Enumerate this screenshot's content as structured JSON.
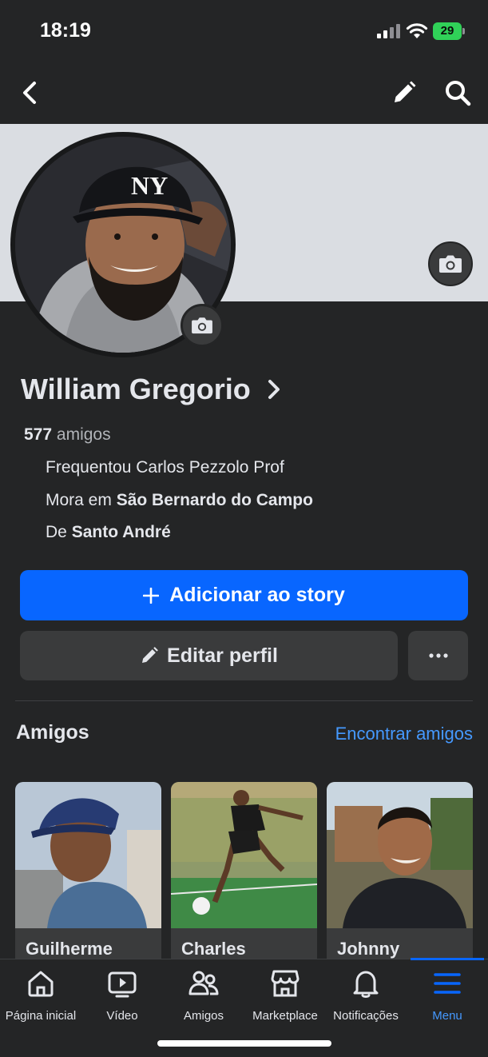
{
  "status_bar": {
    "time": "18:19",
    "battery": "29"
  },
  "profile": {
    "name": "William Gregorio",
    "friends_count": "577",
    "friends_label": "amigos",
    "studied_text": "Frequentou Carlos Pezzolo Prof",
    "lives_prefix": "Mora em",
    "lives_city": "São Bernardo do Campo",
    "from_prefix": "De",
    "from_city": "Santo André"
  },
  "actions": {
    "add_story": "Adicionar ao story",
    "edit_profile": "Editar perfil"
  },
  "friends_section": {
    "title": "Amigos",
    "link": "Encontrar amigos",
    "cards": [
      {
        "name": "Guilherme"
      },
      {
        "name": "Charles"
      },
      {
        "name": "Johnny"
      }
    ]
  },
  "tab_bar": {
    "items": [
      {
        "label": "Página inicial",
        "icon": "home-icon"
      },
      {
        "label": "Vídeo",
        "icon": "video-icon"
      },
      {
        "label": "Amigos",
        "icon": "friends-icon"
      },
      {
        "label": "Marketplace",
        "icon": "marketplace-icon"
      },
      {
        "label": "Notificações",
        "icon": "bell-icon"
      },
      {
        "label": "Menu",
        "icon": "menu-icon"
      }
    ],
    "active": "Menu"
  },
  "colors": {
    "background": "#242526",
    "accent": "#0866ff",
    "link": "#4599ff",
    "button_secondary": "#3a3b3c"
  }
}
